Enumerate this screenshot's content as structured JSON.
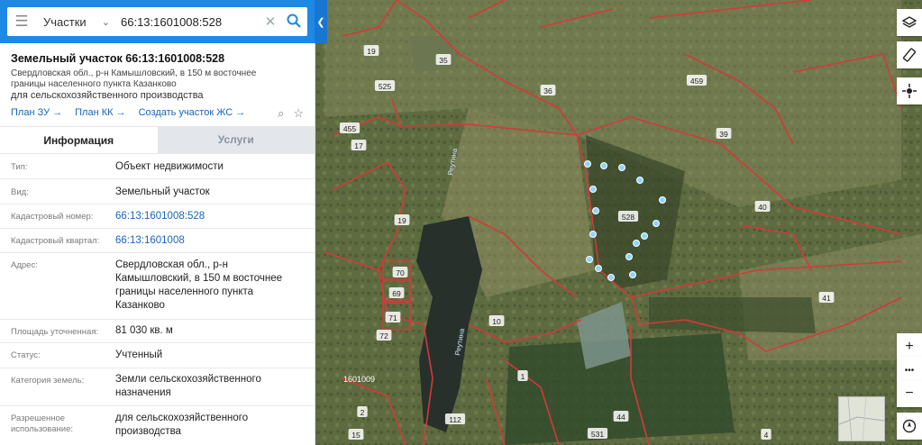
{
  "search": {
    "category": "Участки",
    "query": "66:13:1601008:528"
  },
  "parcel": {
    "title": "Земельный участок 66:13:1601008:528",
    "address_short": "Свердловская обл., р-н Камышловский, в 150 м восточнее границы населенного пункта Казанково",
    "purpose": "для сельскохозяйственного производства",
    "links": [
      "План ЗУ →",
      "План КК →",
      "Создать участок ЖС →"
    ]
  },
  "tabs": {
    "info": "Информация",
    "services": "Услуги"
  },
  "details": [
    {
      "key": "Тип:",
      "value": "Объект недвижимости"
    },
    {
      "key": "Вид:",
      "value": "Земельный участок"
    },
    {
      "key": "Кадастровый номер:",
      "value": "66:13:1601008:528"
    },
    {
      "key": "Кадастровый квартал:",
      "value": "66:13:1601008"
    },
    {
      "key": "Адрес:",
      "value": "Свердловская обл., р-н Камышловский, в 150 м восточнее границы населенного пункта Казанково"
    },
    {
      "key": "Площадь уточненная:",
      "value": "81 030 кв. м"
    },
    {
      "key": "Статус:",
      "value": "Учтенный"
    },
    {
      "key": "Категория земель:",
      "value": "Земли сельскохозяйственного назначения"
    },
    {
      "key": "Разрешенное использование:",
      "value": "для сельскохозяйственного производства"
    }
  ],
  "map": {
    "river_labels": [
      "Реутина",
      "Реутина"
    ],
    "quarter_label": "1601009",
    "parcel_labels": [
      "19",
      "35",
      "36",
      "525",
      "455",
      "17",
      "459",
      "39",
      "40",
      "528",
      "19",
      "70",
      "69",
      "71",
      "72",
      "10",
      "1",
      "41",
      "2",
      "112",
      "15",
      "531",
      "44",
      "4"
    ],
    "controls": [
      "+",
      "•••",
      "−"
    ]
  },
  "colors": {
    "accent": "#1e88e5",
    "boundary": "#d23a3a",
    "link": "#1565c0"
  }
}
